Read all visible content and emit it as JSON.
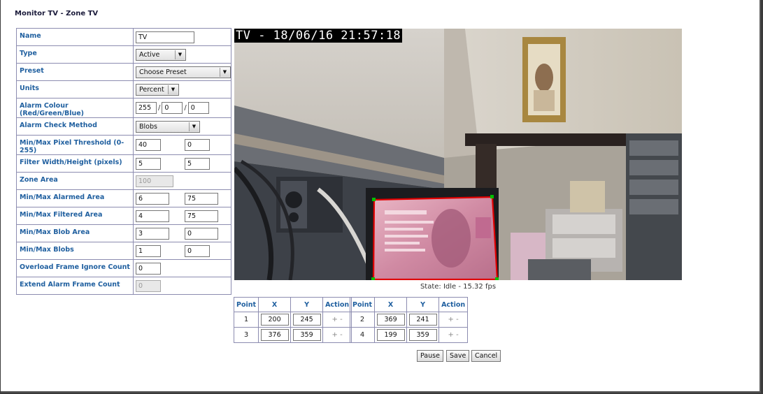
{
  "page": {
    "title": "Monitor TV - Zone TV"
  },
  "fields": {
    "name": {
      "label": "Name",
      "value": "TV"
    },
    "type": {
      "label": "Type",
      "value": "Active"
    },
    "preset": {
      "label": "Preset",
      "value": "Choose Preset"
    },
    "units": {
      "label": "Units",
      "value": "Percent"
    },
    "alarm_colour": {
      "label": "Alarm Colour (Red/Green/Blue)",
      "red": "255",
      "green": "0",
      "blue": "0"
    },
    "alarm_check_method": {
      "label": "Alarm Check Method",
      "value": "Blobs"
    },
    "pixel_threshold": {
      "label": "Min/Max Pixel Threshold (0-255)",
      "min": "40",
      "max": "0"
    },
    "filter_size": {
      "label": "Filter Width/Height (pixels)",
      "width": "5",
      "height": "5"
    },
    "zone_area": {
      "label": "Zone Area",
      "value": "100"
    },
    "alarmed_area": {
      "label": "Min/Max Alarmed Area",
      "min": "6",
      "max": "75"
    },
    "filtered_area": {
      "label": "Min/Max Filtered Area",
      "min": "4",
      "max": "75"
    },
    "blob_area": {
      "label": "Min/Max Blob Area",
      "min": "3",
      "max": "0"
    },
    "blobs": {
      "label": "Min/Max Blobs",
      "min": "1",
      "max": "0"
    },
    "overload_ignore": {
      "label": "Overload Frame Ignore Count",
      "value": "0"
    },
    "extend_alarm": {
      "label": "Extend Alarm Frame Count",
      "value": "0"
    }
  },
  "camera": {
    "overlay_text": "TV - 18/06/16 21:57:18",
    "state": "State: Idle - 15.32 fps"
  },
  "points": {
    "headers": {
      "point": "Point",
      "x": "X",
      "y": "Y",
      "action": "Action"
    },
    "add_remove": "+ -",
    "rows": [
      {
        "n": "1",
        "x": "200",
        "y": "245"
      },
      {
        "n": "2",
        "x": "369",
        "y": "241"
      },
      {
        "n": "3",
        "x": "376",
        "y": "359"
      },
      {
        "n": "4",
        "x": "199",
        "y": "359"
      }
    ]
  },
  "buttons": {
    "pause": "Pause",
    "save": "Save",
    "cancel": "Cancel"
  },
  "colors": {
    "label_blue": "#1f5f9f",
    "border": "#8c8cb0",
    "zone_outline": "#e00000"
  }
}
